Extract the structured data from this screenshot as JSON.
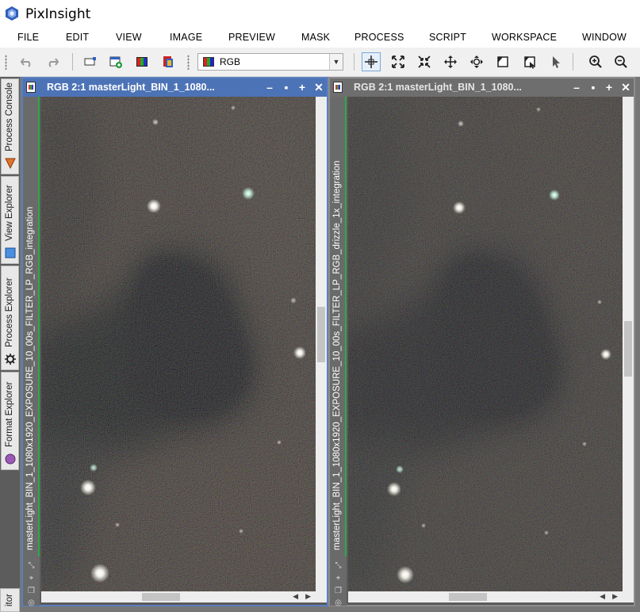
{
  "app": {
    "title": "PixInsight"
  },
  "menu": [
    "FILE",
    "EDIT",
    "VIEW",
    "IMAGE",
    "PREVIEW",
    "MASK",
    "PROCESS",
    "SCRIPT",
    "WORKSPACE",
    "WINDOW"
  ],
  "toolbar": {
    "view_select_value": "RGB",
    "icons": [
      "undo-icon",
      "redo-icon",
      "new-instance-icon",
      "new-image-icon",
      "rgb-channels-icon",
      "mask-icon",
      "readout-mode-icon",
      "zoom-fit-icon",
      "zoom-center-icon",
      "pan-icon",
      "zoom-move-icon",
      "preview-icon",
      "edit-preview-icon",
      "pointer-icon",
      "zoom-in-icon",
      "zoom-out-icon"
    ]
  },
  "side_panels": [
    "Process Console",
    "View Explorer",
    "Process Explorer",
    "Format Explorer"
  ],
  "bottom_panel_label": "itor",
  "windows": [
    {
      "title": "RGB 2:1 masterLight_BIN_1_1080...",
      "identifier": "masterLight_BIN_1_1080x1920_EXPOSURE_10_00s_FILTER_LP_RGB_integration",
      "active": true
    },
    {
      "title": "RGB 2:1 masterLight_BIN_1_1080...",
      "identifier": "masterLight_BIN_1_1080x1920_EXPOSURE_10_00s_FILTER_LP_RGB_drizzle_1x_integration",
      "active": false
    }
  ],
  "colors": {
    "active_title": "#4d73b7",
    "inactive_title": "#6e6e6e",
    "view_id_accent": "#2fa84a",
    "sky_background": "#6a5f57",
    "nebula": "#2f3234"
  }
}
